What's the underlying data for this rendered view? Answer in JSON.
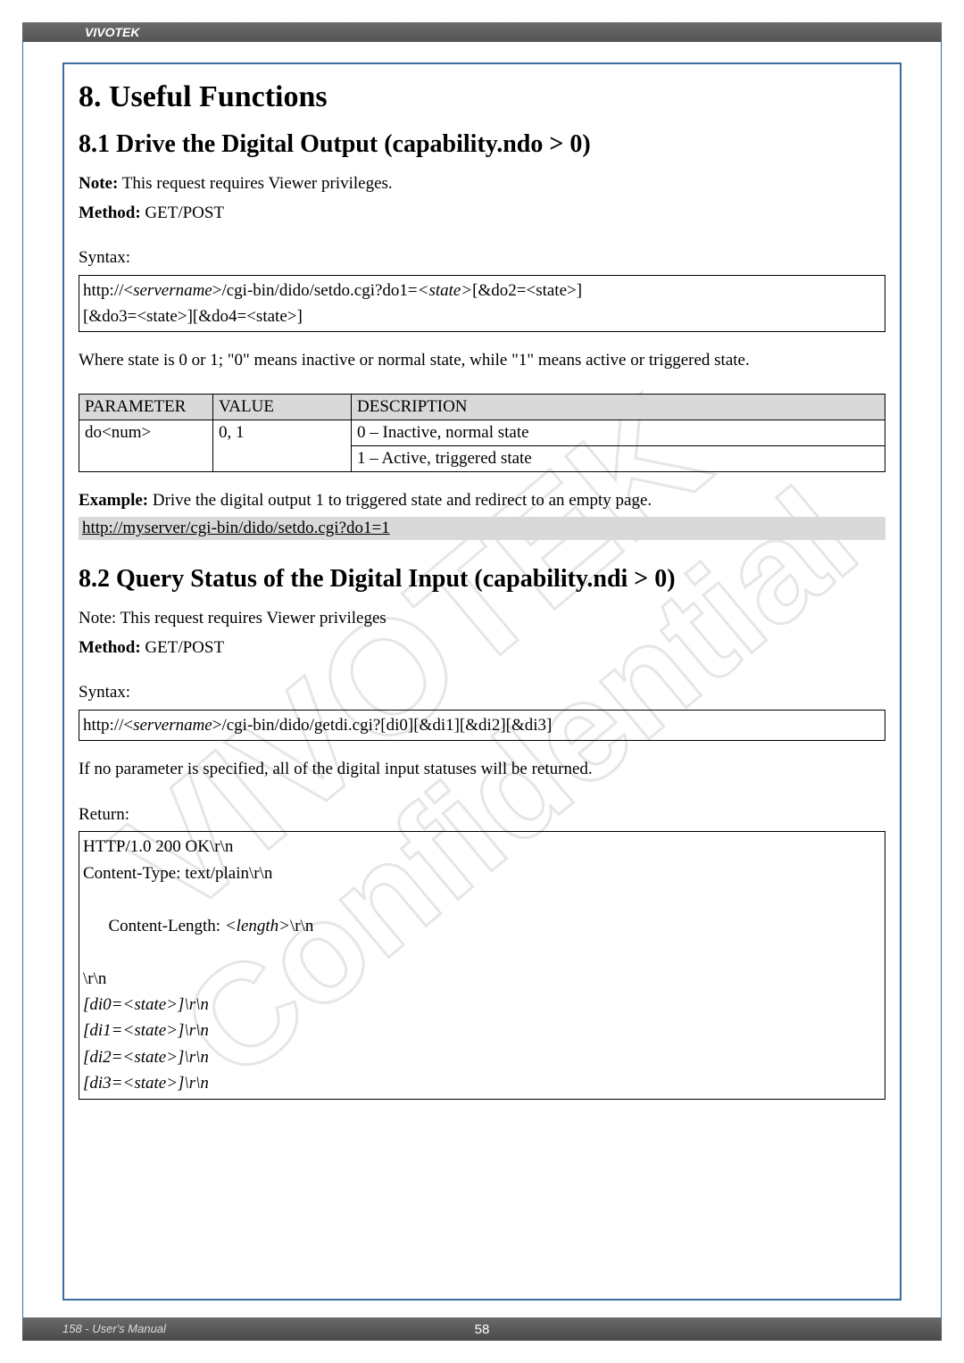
{
  "header": {
    "brand": "VIVOTEK"
  },
  "section8": {
    "title": "8. Useful Functions",
    "s81": {
      "title": "8.1 Drive the Digital Output (capability.ndo > 0)",
      "note_label": "Note:",
      "note_text": " This request requires Viewer privileges.",
      "method_label": "Method:",
      "method_text": " GET/POST",
      "syntax_label": "Syntax:",
      "syntax_line1_a": "http://<",
      "syntax_line1_b": "servername",
      "syntax_line1_c": ">/cgi-bin/dido/setdo.cgi?do1=",
      "syntax_line1_d": "<state>",
      "syntax_line1_e": "[&do2=<state>]",
      "syntax_line2": "[&do3=<state>][&do4=<state>]",
      "where_text": "Where state is 0 or 1; \"0\" means inactive or normal state, while \"1\" means active or triggered state.",
      "table": {
        "h1": "PARAMETER",
        "h2": "VALUE",
        "h3": "DESCRIPTION",
        "r1c1": "do<num>",
        "r1c2": "0, 1",
        "r1c3a": "0 – Inactive, normal state",
        "r1c3b": "1 – Active, triggered state"
      },
      "example_label": "Example:",
      "example_text": " Drive the digital output 1 to triggered state and redirect to an empty page.",
      "example_link": "http://myserver/cgi-bin/dido/setdo.cgi?do1=1"
    },
    "s82": {
      "title": "8.2 Query Status of the Digital Input (capability.ndi > 0)",
      "note_text": "Note: This request requires Viewer privileges",
      "method_label": "Method:",
      "method_text": " GET/POST",
      "syntax_label": "Syntax:",
      "syntax_a": "http://<",
      "syntax_b": "servername",
      "syntax_c": ">/cgi-bin/dido/getdi.cgi?[di0][&di1][&di2][&di3]",
      "ifno_text": "If no parameter is specified, all of the digital input statuses will be returned.",
      "return_label": "Return:",
      "return_lines": {
        "l1": "HTTP/1.0 200 OK\\r\\n",
        "l2": "Content-Type: text/plain\\r\\n",
        "l3a": "Content-Length: ",
        "l3b": "<length>",
        "l3c": "\\r\\n",
        "l4": "\\r\\n",
        "l5": "[di0=<state>]\\r\\n",
        "l6": "[di1=<state>]\\r\\n",
        "l7": "[di2=<state>]\\r\\n",
        "l8": "[di3=<state>]\\r\\n"
      }
    }
  },
  "footer": {
    "left": "158 - User's Manual",
    "center": "58"
  }
}
